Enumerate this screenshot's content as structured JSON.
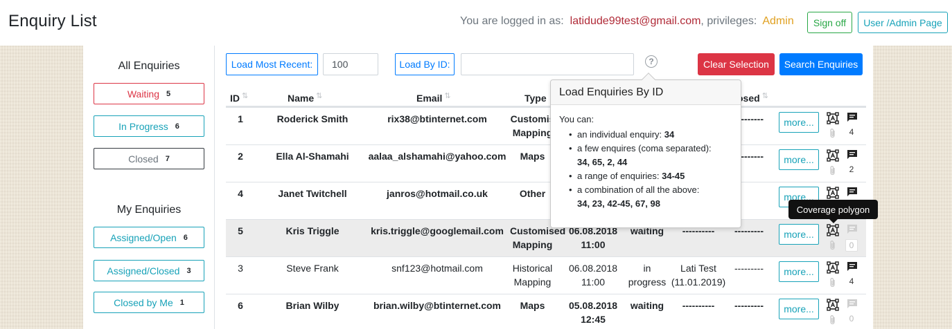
{
  "header": {
    "title": "Enquiry List",
    "logged_in_label": "You are logged in as:",
    "user_email": "latidude99test@gmail.com",
    "privileges_label": ", privileges:",
    "privileges_value": "Admin",
    "sign_off": "Sign off",
    "admin_page": "User /Admin Page"
  },
  "sidebar": {
    "all_title": "All Enquiries",
    "my_title": "My Enquiries",
    "all_filters": [
      {
        "label": "Waiting",
        "count": "5"
      },
      {
        "label": "In Progress",
        "count": "6"
      },
      {
        "label": "Closed",
        "count": "7"
      }
    ],
    "my_filters": [
      {
        "label": "Assigned/Open",
        "count": "6"
      },
      {
        "label": "Assigned/Closed",
        "count": "3"
      },
      {
        "label": "Closed by Me",
        "count": "1"
      }
    ]
  },
  "toolbar": {
    "load_recent": "Load Most Recent:",
    "recent_value": "100",
    "load_by_id": "Load By ID:",
    "id_value": "",
    "help": "?",
    "clear": "Clear Selection",
    "search": "Search Enquiries"
  },
  "table": {
    "columns": {
      "id": "ID",
      "name": "Name",
      "email": "Email",
      "type": "Type",
      "closed": "osed"
    },
    "more_label": "more...",
    "rows": [
      {
        "id": "1",
        "name": "Roderick Smith",
        "email": "rix38@btinternet.com",
        "type1": "Customis",
        "type2": "Mapping",
        "date1": "",
        "date2": "",
        "status1": "",
        "status2": "",
        "assigned1": "",
        "assigned2": "",
        "closed": "---------",
        "comments": "4",
        "bold": true
      },
      {
        "id": "2",
        "name": "Ella Al-Shamahi",
        "email": "aalaa_alshamahi@yahoo.com",
        "type1": "Maps",
        "type2": "",
        "date1": "",
        "date2": "",
        "status1": "",
        "status2": "",
        "assigned1": "",
        "assigned2": "",
        "closed": "---------",
        "comments": "2",
        "bold": true
      },
      {
        "id": "4",
        "name": "Janet Twitchell",
        "email": "janros@hotmail.co.uk",
        "type1": "Other",
        "type2": "",
        "date1": "",
        "date2": "",
        "status1": "",
        "status2": "",
        "assigned1": "",
        "assigned2": "",
        "closed": "",
        "comments": "",
        "bold": true
      },
      {
        "id": "5",
        "name": "Kris Triggle",
        "email": "kris.triggle@googlemail.com",
        "type1": "Customised",
        "type2": "Mapping",
        "date1": "06.08.2018",
        "date2": "11:00",
        "status1": "waiting",
        "status2": "",
        "assigned1": "----------",
        "assigned2": "",
        "closed": "---------",
        "comments": "0",
        "bold": true
      },
      {
        "id": "3",
        "name": "Steve Frank",
        "email": "snf123@hotmail.com",
        "type1": "Historical",
        "type2": "Mapping",
        "date1": "06.08.2018",
        "date2": "11:00",
        "status1": "in",
        "status2": "progress",
        "assigned1": "Lati Test",
        "assigned2": "(11.01.2019)",
        "closed": "---------",
        "comments": "4",
        "bold": false
      },
      {
        "id": "6",
        "name": "Brian Wilby",
        "email": "brian.wilby@btinternet.com",
        "type1": "Maps",
        "type2": "",
        "date1": "05.08.2018",
        "date2": "12:45",
        "status1": "waiting",
        "status2": "",
        "assigned1": "----------",
        "assigned2": "",
        "closed": "---------",
        "comments": "0",
        "bold": true
      }
    ]
  },
  "popover": {
    "title": "Load Enquiries By ID",
    "intro": "You can:",
    "items": [
      {
        "text": "an individual enquiry: ",
        "example": "34"
      },
      {
        "text": "a few enquires (coma separated):",
        "example": "34, 65, 2, 44"
      },
      {
        "text": "a range of enquiries: ",
        "example": "34-45"
      },
      {
        "text": "a combination of all the above:",
        "example": "34, 23, 42-45, 67, 98"
      }
    ]
  },
  "tooltip": "Coverage polygon",
  "colors": {
    "danger": "#dc3545",
    "primary": "#007bff",
    "info": "#17a2b8",
    "success": "#28a745",
    "warning": "#e0a020"
  }
}
